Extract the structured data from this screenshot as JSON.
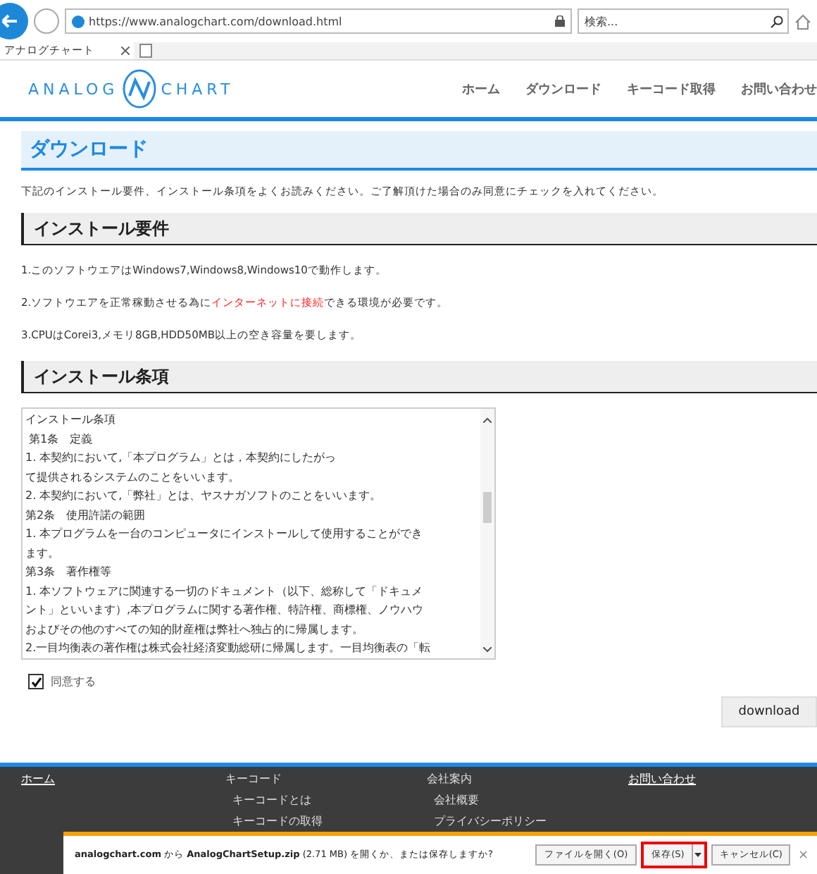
{
  "browser": {
    "url": "https://www.analogchart.com/download.html",
    "search": {
      "placeholder": "検索..."
    },
    "tab": {
      "title": "アナログチャート",
      "selected": true
    }
  },
  "site_header": {
    "logo_left": "ANALOG",
    "logo_right": "CHART",
    "nav": [
      {
        "label": "ホーム"
      },
      {
        "label": "ダウンロード"
      },
      {
        "label": "キーコード取得"
      },
      {
        "label": "お問い合わせ"
      }
    ]
  },
  "page_title": "ダウンロード",
  "intro": "下記のインストール要件、インストール条項をよくお読みください。ご了解頂けた場合のみ同意にチェックを入れてください。",
  "requirements": {
    "heading": "インストール要件",
    "items": [
      [
        {
          "text": "1.このソフトウエアはWindows7,Windows8,Windows10で動作します。",
          "emphasis": false
        }
      ],
      [
        {
          "text": "2.ソフトウエアを正常稼動させる為に",
          "emphasis": false
        },
        {
          "text": "インターネットに接続",
          "emphasis": true
        },
        {
          "text": "できる環境が必要です。",
          "emphasis": false
        }
      ],
      [
        {
          "text": "3.CPUはCorei3,メモリ8GB,HDD50MB以上の空き容量を要します。",
          "emphasis": false
        }
      ]
    ]
  },
  "terms": {
    "heading": "インストール条項",
    "lines": [
      "インストール条項",
      " 第1条　定義",
      "1. 本契約において,「本プログラム」とは，本契約にしたがっ",
      "て提供されるシステムのことをいいます。",
      "2. 本契約において,「弊社」とは、ヤスナガソフトのことをいいます。",
      "第2条　使用許諾の範囲",
      "1. 本プログラムを一台のコンピュータにインストールして使用することができ",
      "ます。",
      "第3条　著作権等",
      "1. 本ソフトウェアに関連する一切のドキュメント（以下、総称して「ドキュメ",
      "ント」といいます）,本プログラムに関する著作権、特許権、商標権、ノウハウ",
      "およびその他のすべての知的財産権は弊社へ独占的に帰属します。",
      "2.一目均衡表の著作権は株式会社経済変動総研に帰属します。一目均衡表の「転"
    ],
    "agree": {
      "label": "同意する",
      "checked": true
    }
  },
  "download_button": "download",
  "footer": {
    "columns": [
      {
        "heading": "ホーム",
        "link": true
      },
      {
        "heading": "キーコード",
        "link": false,
        "items": [
          "キーコードとは",
          "キーコードの取得"
        ]
      },
      {
        "heading": "会社案内",
        "link": false,
        "items": [
          "会社概要",
          "プライバシーポリシー"
        ]
      },
      {
        "heading": "お問い合わせ",
        "link": true
      }
    ]
  },
  "download_bar": {
    "message": "**analogchart.com** から **AnalogChartSetup.zip** (2.71 MB) を開くか、または保存しますか?",
    "buttons": [
      {
        "label": "ファイルを開く(O)",
        "kind": "plain",
        "highlighted": false
      },
      {
        "label": "保存(S)",
        "kind": "split",
        "highlighted": true
      },
      {
        "label": "キャンセル(C)",
        "kind": "plain",
        "highlighted": false
      }
    ],
    "close": "×"
  }
}
